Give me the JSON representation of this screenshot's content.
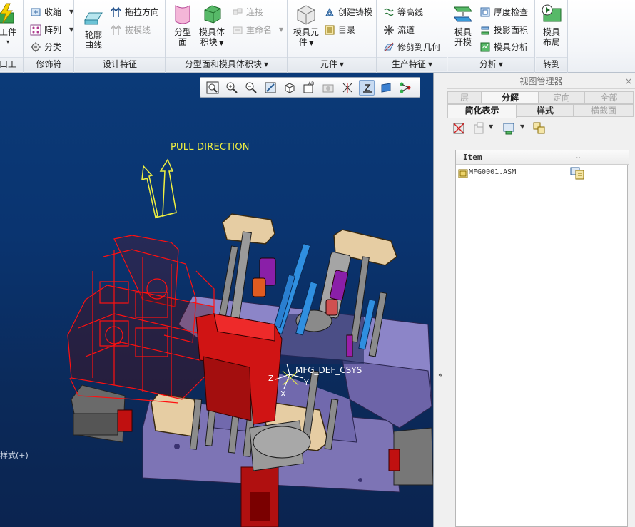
{
  "ribbon": {
    "groups": {
      "g1": {
        "label": "口工件",
        "big": "工件"
      },
      "g2": {
        "label": "修饰符",
        "items": [
          "收缩",
          "阵列",
          "分类"
        ]
      },
      "g3": {
        "label": "设计特征",
        "big": [
          "轮廓",
          "曲线"
        ],
        "items": [
          "拖拉方向",
          "拔模线"
        ]
      },
      "g4": {
        "label": "分型面和模具体积块",
        "big1": [
          "分型",
          "面"
        ],
        "big2": [
          "模具体",
          "积块"
        ],
        "items": [
          "连接",
          "重命名"
        ]
      },
      "g5": {
        "label": "元件",
        "big": [
          "模具元",
          "件"
        ],
        "items": [
          "创建铸模",
          "目录"
        ]
      },
      "g6": {
        "label": "生产特征",
        "items": [
          "等高线",
          "流道",
          "修剪到几何"
        ]
      },
      "g7": {
        "label": "分析",
        "big": [
          "模具",
          "开模"
        ],
        "items": [
          "厚度检查",
          "投影面积",
          "模具分析"
        ]
      },
      "g8": {
        "label": "转到",
        "big": [
          "模具",
          "布局"
        ]
      }
    }
  },
  "viewport": {
    "pull_direction": "PULL DIRECTION",
    "csys_label": "MFG_DEF_CSYS",
    "axis_labels": {
      "z": "Z",
      "x": "X",
      "y": "Y"
    },
    "style_text": "样式(+)",
    "background_top": "#0b3a78",
    "background_bottom": "#0b2450",
    "mold_highlight_color": "#ff0000"
  },
  "view_toolbar": {
    "buttons": [
      "refit-icon",
      "zoom-in-icon",
      "zoom-out-icon",
      "repaint-icon",
      "orientation-icon",
      "saved-views-icon",
      "display-style-icon",
      "datum-display-icon",
      "annotation-icon",
      "spin-center-icon",
      "model-tree-icon"
    ]
  },
  "view_manager": {
    "title": "视图管理器",
    "close": "×",
    "tabs_row1": [
      "层",
      "分解",
      "定向",
      "全部"
    ],
    "tabs_row2": [
      "简化表示",
      "样式",
      "横截面"
    ],
    "columns": {
      "item": "Item",
      "more": ".."
    },
    "tree": [
      {
        "name": "MFG0001.ASM"
      }
    ]
  },
  "splitter": {
    "collapse": "«"
  }
}
